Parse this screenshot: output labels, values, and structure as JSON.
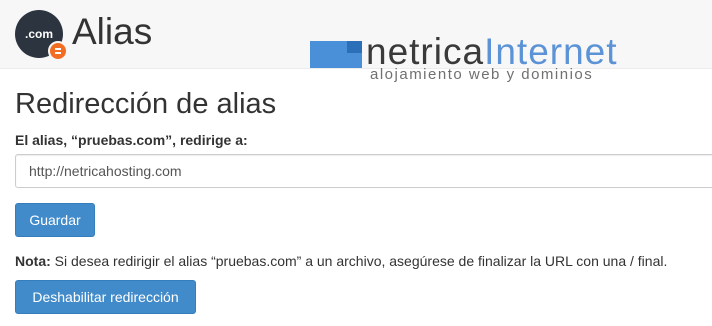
{
  "app": {
    "icon_text": ".com",
    "title": "Alias"
  },
  "brand": {
    "name_part1": "netrica",
    "name_part2": "Internet",
    "tagline": "alojamiento web y dominios"
  },
  "main": {
    "heading": "Redirección de alias",
    "field_label": "El alias, “pruebas.com”, redirige a:",
    "url_value": "http://netricahosting.com",
    "save_label": "Guardar",
    "note_label": "Nota:",
    "note_text": " Si desea redirigir el alias “pruebas.com” a un archivo, asegúrese de finalizar la URL con una / final.",
    "disable_label": "Deshabilitar redirección"
  },
  "colors": {
    "primary_button": "#428bca",
    "badge": "#f26d21",
    "brand_blue": "#4a90d9"
  },
  "icons": {
    "app_icon": "domain-com-icon",
    "badge_icon": "redirect-badge-icon"
  }
}
